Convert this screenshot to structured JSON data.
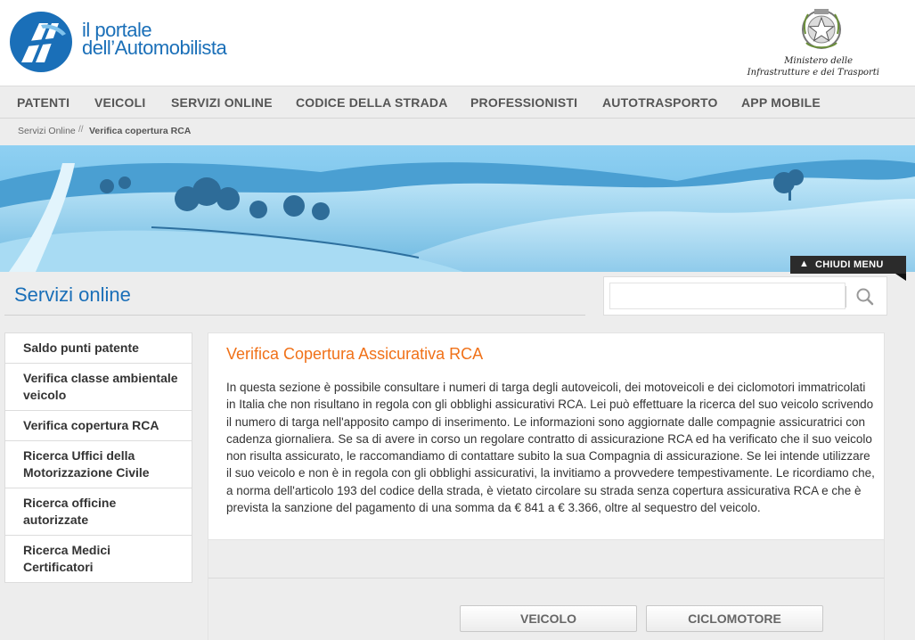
{
  "header": {
    "logo_line1": "il portale",
    "logo_line2": "dell’Automobilista",
    "ministry_line1": "Ministero delle",
    "ministry_line2": "Infrastrutture e dei Trasporti"
  },
  "nav": {
    "items": [
      "PATENTI",
      "VEICOLI",
      "SERVIZI ONLINE",
      "CODICE DELLA STRADA",
      "PROFESSIONISTI",
      "AUTOTRASPORTO",
      "APP MOBILE"
    ]
  },
  "breadcrumb": {
    "home": "Servizi Online",
    "separator": "//",
    "current": "Verifica copertura RCA"
  },
  "close_menu": {
    "label": "CHIUDI MENU"
  },
  "section": {
    "title": "Servizi online"
  },
  "search": {
    "placeholder": "",
    "value": ""
  },
  "sidebar": {
    "items": [
      {
        "label": "Saldo punti patente"
      },
      {
        "label": "Verifica classe ambientale veicolo"
      },
      {
        "label": "Verifica copertura RCA"
      },
      {
        "label": "Ricerca Uffici della Motorizzazione Civile"
      },
      {
        "label": "Ricerca officine autorizzate"
      },
      {
        "label": "Ricerca Medici Certificatori"
      }
    ]
  },
  "content": {
    "title": "Verifica Copertura Assicurativa RCA",
    "text": "In questa sezione è possibile consultare i numeri di targa degli autoveicoli, dei motoveicoli e dei ciclomotori immatricolati in Italia che non risultano in regola con gli obblighi assicurativi RCA. Lei può effettuare la ricerca del suo veicolo scrivendo il numero di targa nell'apposito campo di inserimento. Le informazioni sono aggiornate dalle compagnie assicuratrici con cadenza giornaliera. Se sa di avere in corso un regolare contratto di assicurazione RCA ed ha verificato che il suo veicolo non risulta assicurato, le raccomandiamo di contattare subito la sua Compagnia di assicurazione. Se lei intende utilizzare il suo veicolo e non è in regola con gli obblighi assicurativi, la invitiamo a provvedere tempestivamente. Le ricordiamo che, a norma dell'articolo 193 del codice della strada, è vietato circolare su strada senza copertura assicurativa RCA e che è prevista la sanzione del pagamento di una somma da € 841 a € 3.366, oltre al sequestro del veicolo."
  },
  "buttons": {
    "veicolo": "VEICOLO",
    "ciclomotore": "CICLOMOTORE"
  },
  "colors": {
    "brand_blue": "#1a6fb8",
    "title_orange": "#f07118",
    "banner_tint": "#3a9fd6"
  }
}
